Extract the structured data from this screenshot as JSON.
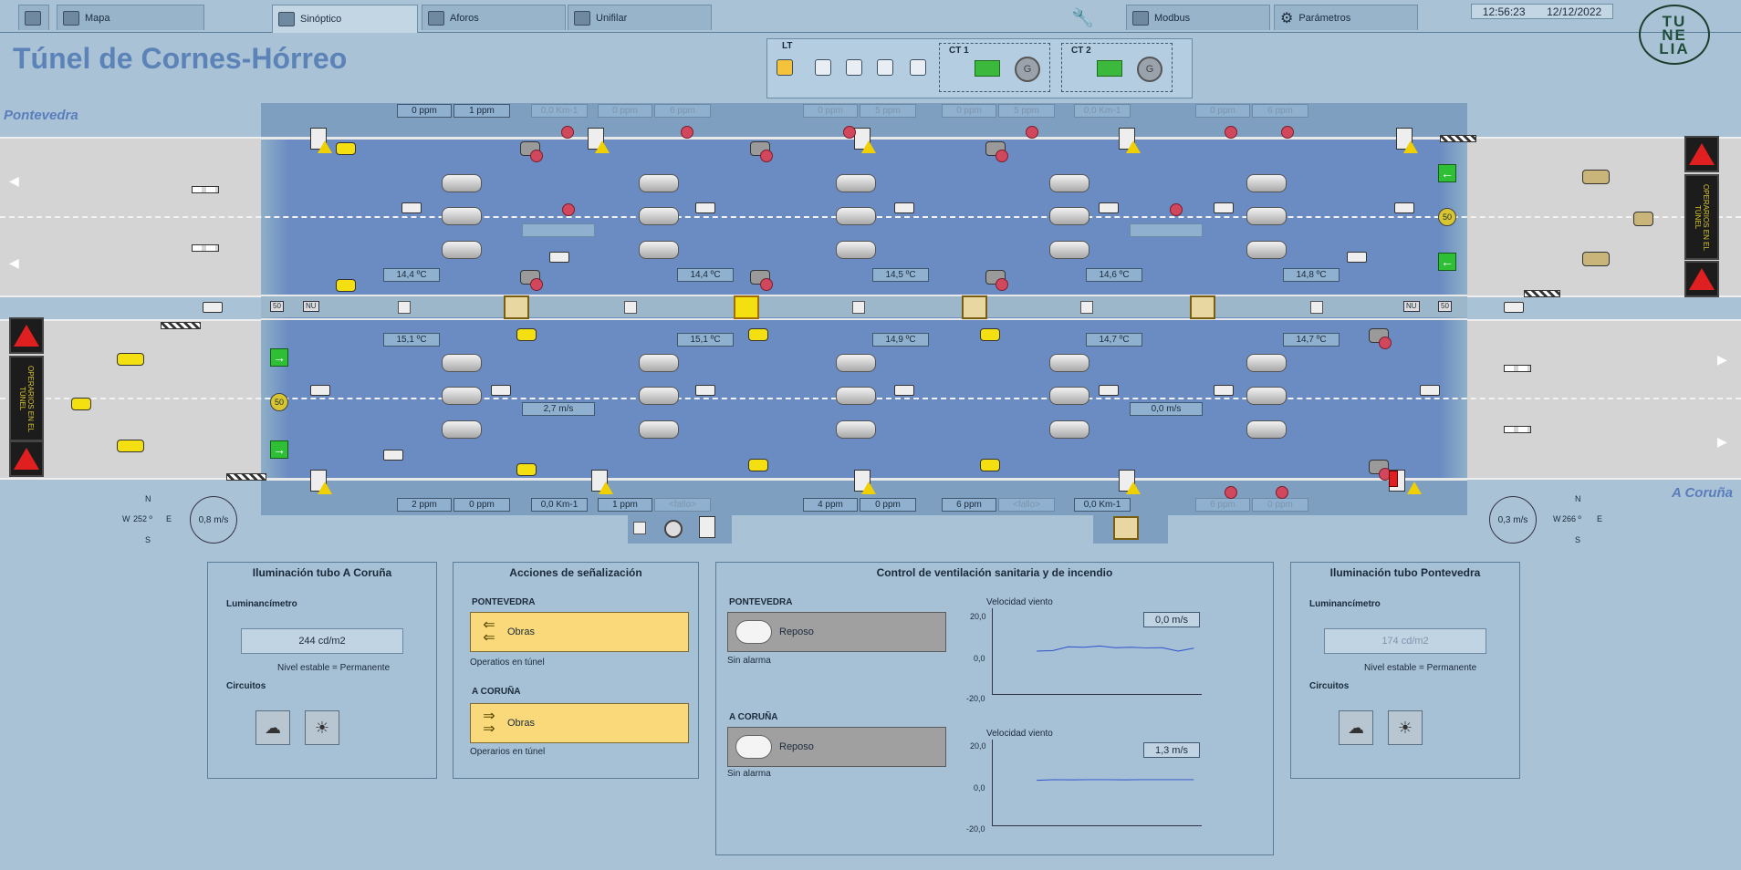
{
  "tabs": [
    {
      "label": "Mapa"
    },
    {
      "label": "Sinóptico"
    },
    {
      "label": "Aforos"
    },
    {
      "label": "Unifilar"
    },
    {
      "label": "Modbus"
    },
    {
      "label": "Parámetros"
    }
  ],
  "clock": {
    "time": "12:56:23",
    "date": "12/12/2022"
  },
  "logo": {
    "line1": "TU",
    "line2": "NE",
    "line3": "LIA"
  },
  "title": "Túnel de Cornes-Hórreo",
  "cities": {
    "left": "Pontevedra",
    "right": "A Coruña"
  },
  "lt_panel": {
    "lt_label": "LT",
    "ct1_label": "CT 1",
    "ct2_label": "CT 2",
    "gen_label": "G"
  },
  "top_gas": [
    {
      "value": "0 ppm",
      "dim": false
    },
    {
      "value": "1 ppm",
      "dim": false
    },
    {
      "value": "0,0 Km-1",
      "dim": true
    },
    {
      "value": "0 ppm",
      "dim": true
    },
    {
      "value": "6 ppm",
      "dim": true
    },
    {
      "value": "0 ppm",
      "dim": true
    },
    {
      "value": "5 ppm",
      "dim": true
    },
    {
      "value": "0 ppm",
      "dim": true
    },
    {
      "value": "5 ppm",
      "dim": true
    },
    {
      "value": "0,0 Km-1",
      "dim": true
    },
    {
      "value": "0 ppm",
      "dim": true
    },
    {
      "value": "6 ppm",
      "dim": true
    }
  ],
  "bottom_gas": [
    {
      "value": "2 ppm",
      "dim": false
    },
    {
      "value": "0 ppm",
      "dim": false
    },
    {
      "value": "0,0 Km-1",
      "dim": false
    },
    {
      "value": "1 ppm",
      "dim": false
    },
    {
      "value": "<fallo>",
      "dim": true
    },
    {
      "value": "4 ppm",
      "dim": false
    },
    {
      "value": "0 ppm",
      "dim": false
    },
    {
      "value": "6 ppm",
      "dim": false
    },
    {
      "value": "<fallo>",
      "dim": true
    },
    {
      "value": "0,0 Km-1",
      "dim": false
    },
    {
      "value": "6 ppm",
      "dim": true
    },
    {
      "value": "0 ppm",
      "dim": true
    }
  ],
  "temps_upper": [
    "14,4 ºC",
    "14,4 ºC",
    "14,5 ºC",
    "14,6 ºC",
    "14,8 ºC"
  ],
  "temps_lower": [
    "15,1 ºC",
    "15,1 ºC",
    "14,9 ºC",
    "14,7 ºC",
    "14,7 ºC"
  ],
  "tube_wind": {
    "upper_left": "",
    "upper_right": "",
    "lower_left": "2,7 m/s",
    "lower_right": "0,0 m/s"
  },
  "gallery_badges": {
    "left1": "50",
    "left2": "NU",
    "right1": "NU",
    "right2": "50"
  },
  "speed_sign": "50",
  "vertical_sign_text": "OPERARIOS EN EL TÚNEL",
  "anemo_left": {
    "n": "N",
    "s": "S",
    "w": "W",
    "e": "E",
    "value": "0,8 m/s",
    "dir": "252 º"
  },
  "anemo_right": {
    "n": "N",
    "s": "S",
    "w": "W",
    "e": "E",
    "value": "0,3 m/s",
    "dir": "266 º"
  },
  "panel_ilum_coruna": {
    "title": "Iluminación tubo A Coruña",
    "luminancimetro": "Luminancímetro",
    "value": "244 cd/m2",
    "nivel": "Nivel estable = Permanente",
    "circuitos": "Circuitos"
  },
  "panel_acciones": {
    "title": "Acciones de señalización",
    "pontevedra": "PONTEVEDRA",
    "pontevedra_action": "Obras",
    "pontevedra_note": "Operatios en túnel",
    "coruna": "A CORUÑA",
    "coruna_action": "Obras",
    "coruna_note": "Operarios en túnel"
  },
  "panel_ventilacion": {
    "title": "Control de ventilación sanitaria y de incendio",
    "pontevedra": "PONTEVEDRA",
    "pontevedra_state": "Reposo",
    "pontevedra_alarm": "Sin alarma",
    "coruna": "A CORUÑA",
    "coruna_state": "Reposo",
    "coruna_alarm": "Sin alarma",
    "chart_label_1": "Velocidad viento",
    "chart_label_2": "Velocidad viento",
    "wind_1": "0,0 m/s",
    "wind_2": "1,3 m/s",
    "axis": [
      "20,0",
      "0,0",
      "-20,0"
    ]
  },
  "panel_ilum_pontevedra": {
    "title": "Iluminación tubo Pontevedra",
    "luminancimetro": "Luminancímetro",
    "value": "174 cd/m2",
    "nivel": "Nivel estable = Permanente",
    "circuitos": "Circuitos"
  },
  "chart_data": [
    {
      "type": "line",
      "ylim": [
        -20,
        20
      ],
      "series": [
        {
          "values": [
            0.0,
            0.2,
            2.0,
            1.8,
            2.4,
            1.6,
            1.8,
            1.5,
            1.6,
            0.0,
            1.4
          ]
        }
      ]
    },
    {
      "type": "line",
      "ylim": [
        -20,
        20
      ],
      "series": [
        {
          "values": [
            1.0,
            1.3,
            1.2,
            1.3,
            1.3,
            1.2,
            1.3,
            1.3,
            1.3,
            1.3
          ]
        }
      ]
    }
  ],
  "colors": {
    "tube": "#6b8cc2",
    "road": "#d4d4d4",
    "bg": "#a9c2d6",
    "action": "#fad97a",
    "alarm": "#e02020"
  }
}
